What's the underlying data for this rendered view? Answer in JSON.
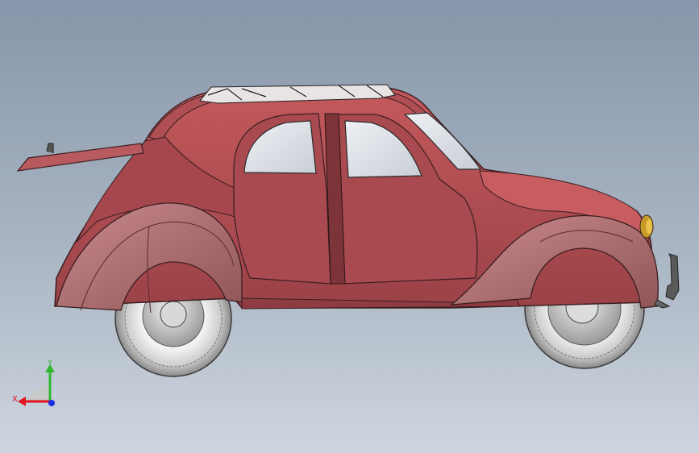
{
  "viewport": {
    "background_top": "#8796aa",
    "background_bottom": "#cdd5df",
    "model_color": "#a9474e"
  },
  "triad": {
    "x_label": "X",
    "y_label": "Y",
    "x_color": "#e0141e",
    "y_color": "#2eb82e",
    "z_color": "#1b2ee6"
  }
}
